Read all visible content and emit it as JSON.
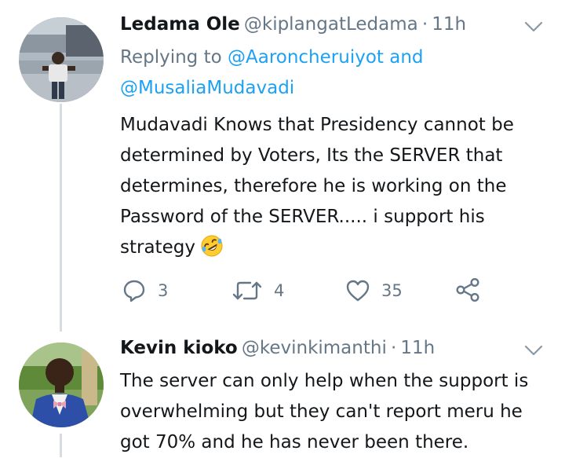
{
  "tweet1": {
    "name": "Ledama Ole",
    "handle": "@kiplangatLedama",
    "dot": "·",
    "time": "11h",
    "replying_prefix": "Replying to",
    "mention1": "@Aaroncheruiyot",
    "and": "and",
    "mention2": "@MusaliaMudavadi",
    "lines": [
      "Mudavadi Knows that Presidency cannot be",
      "determined by Voters, Its the SERVER that",
      "determines, therefore he is working on the",
      "Password of the SERVER..... i support his",
      "strategy"
    ],
    "reply_count": "3",
    "retweet_count": "4",
    "like_count": "35"
  },
  "tweet2": {
    "name": "Kevin kioko",
    "handle": "@kevinkimanthi",
    "dot": "·",
    "time": "11h",
    "lines": [
      "The server can only help when the support is",
      "overwhelming but they can't report meru he",
      "got 70% and he has never been there."
    ]
  },
  "colors": {
    "link": "#1da1f2",
    "muted": "#657786",
    "text": "#14171a",
    "thread": "#d6dce1"
  },
  "icons": {
    "reply": "reply-icon",
    "retweet": "retweet-icon",
    "like": "heart-icon",
    "share": "share-icon",
    "menu": "chevron-down-icon",
    "emoji": "rolling-laughing-emoji-icon"
  }
}
